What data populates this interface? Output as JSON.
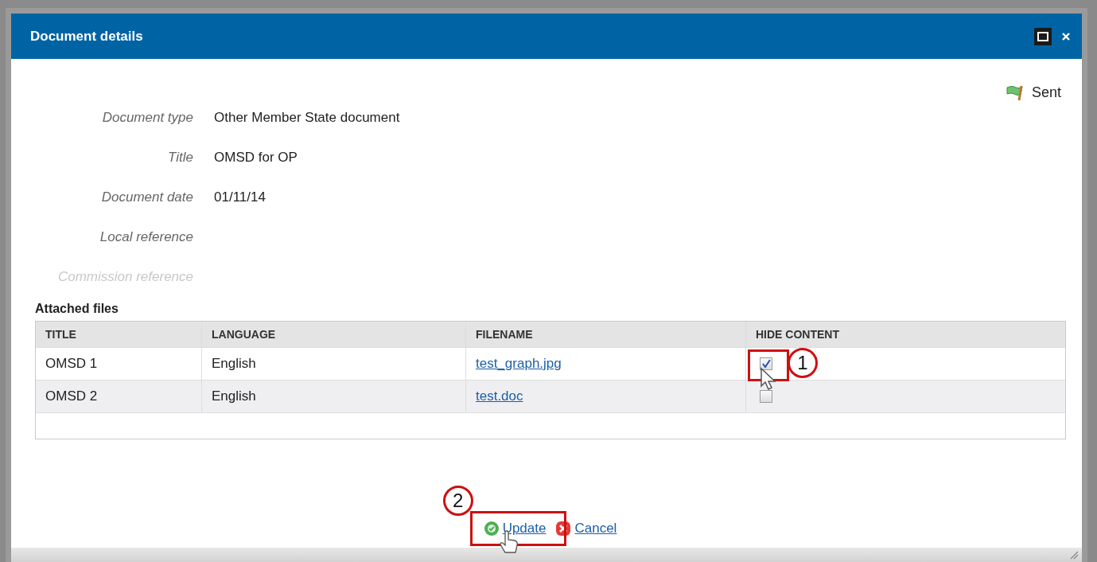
{
  "dialog": {
    "title": "Document details"
  },
  "status": {
    "label": "Sent"
  },
  "fields": [
    {
      "label": "Document type",
      "value": "Other Member State document",
      "disabled": false
    },
    {
      "label": "Title",
      "value": "OMSD for OP",
      "disabled": false
    },
    {
      "label": "Document date",
      "value": "01/11/14",
      "disabled": false
    },
    {
      "label": "Local reference",
      "disabled": false
    },
    {
      "label": "Commission reference",
      "disabled": true
    }
  ],
  "attached_files": {
    "heading": "Attached files",
    "columns": [
      "TITLE",
      "LANGUAGE",
      "FILENAME",
      "HIDE CONTENT"
    ],
    "rows": [
      {
        "title": "OMSD 1",
        "language": "English",
        "filename": "test_graph.jpg",
        "hide_content": true
      },
      {
        "title": "OMSD 2",
        "language": "English",
        "filename": "test.doc",
        "hide_content": false
      }
    ]
  },
  "buttons": [
    {
      "kind": "update",
      "label": "Update"
    },
    {
      "kind": "cancel",
      "label": "Cancel"
    }
  ],
  "callouts": [
    "1",
    "2"
  ]
}
